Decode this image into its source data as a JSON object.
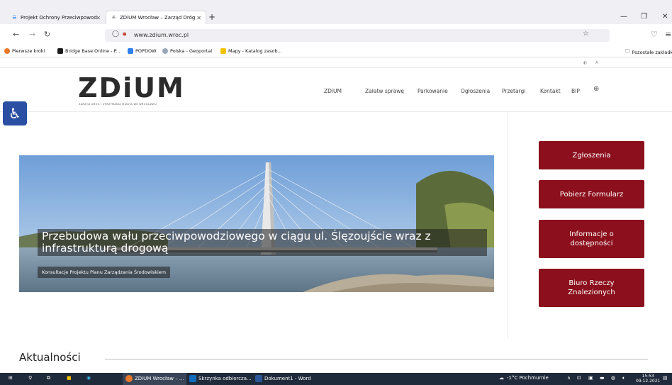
{
  "browser": {
    "tabs": [
      {
        "label": "Projekt Ochrony Przeciwpowodziowej",
        "icon": "db-icon",
        "active": false
      },
      {
        "label": "ZDiUM Wrocław – Zarząd Dróg",
        "icon": "zdium-favicon",
        "active": true
      }
    ],
    "url": "www.zdium.wroc.pl",
    "bookmarks": [
      {
        "label": "Pierwsze kroki",
        "color": "#e8782b"
      },
      {
        "label": "Bridge Base Online - P...",
        "color": "#1a1a1a"
      },
      {
        "label": "POPDOW",
        "color": "#2f80ed"
      },
      {
        "label": "Polska - Geoportal",
        "color": "#9aa7b8"
      },
      {
        "label": "Mapy - Katalog zasob...",
        "color": "#f2c200"
      }
    ],
    "other_bookmarks": "Pozostałe zakładki"
  },
  "site": {
    "logo": "ZDiUM",
    "logo_sub": "ZARZĄD DRÓG I UTRZYMANIA MIASTA WE WROCŁAWIU",
    "menu": [
      "ZDiUM",
      "Załatw sprawę",
      "Parkowanie",
      "Ogłoszenia",
      "Przetargi",
      "Kontakt",
      "BIP"
    ],
    "hero": {
      "title": "Przebudowa wału przeciwpowodziowego w ciągu ul. Ślęzoujście wraz z infrastrukturą drogową",
      "subtitle": "Konsultacje Projektu Planu Zarządzania Środowiskiem"
    },
    "side_buttons": [
      "Zgłoszenia",
      "Pobierz Formularz",
      "Informacje o dostępności",
      "Biuro Rzeczy Znalezionych"
    ],
    "news_heading": "Aktualności",
    "accent": "#8b0f1c"
  },
  "taskbar": {
    "apps": [
      "ZDiUM Wrocław – ...",
      "Skrzynka odbiorcza...",
      "Dokument1 - Word"
    ],
    "weather": "-1°C Pochmurnie",
    "time": "15:53",
    "date": "09.12.2021"
  }
}
